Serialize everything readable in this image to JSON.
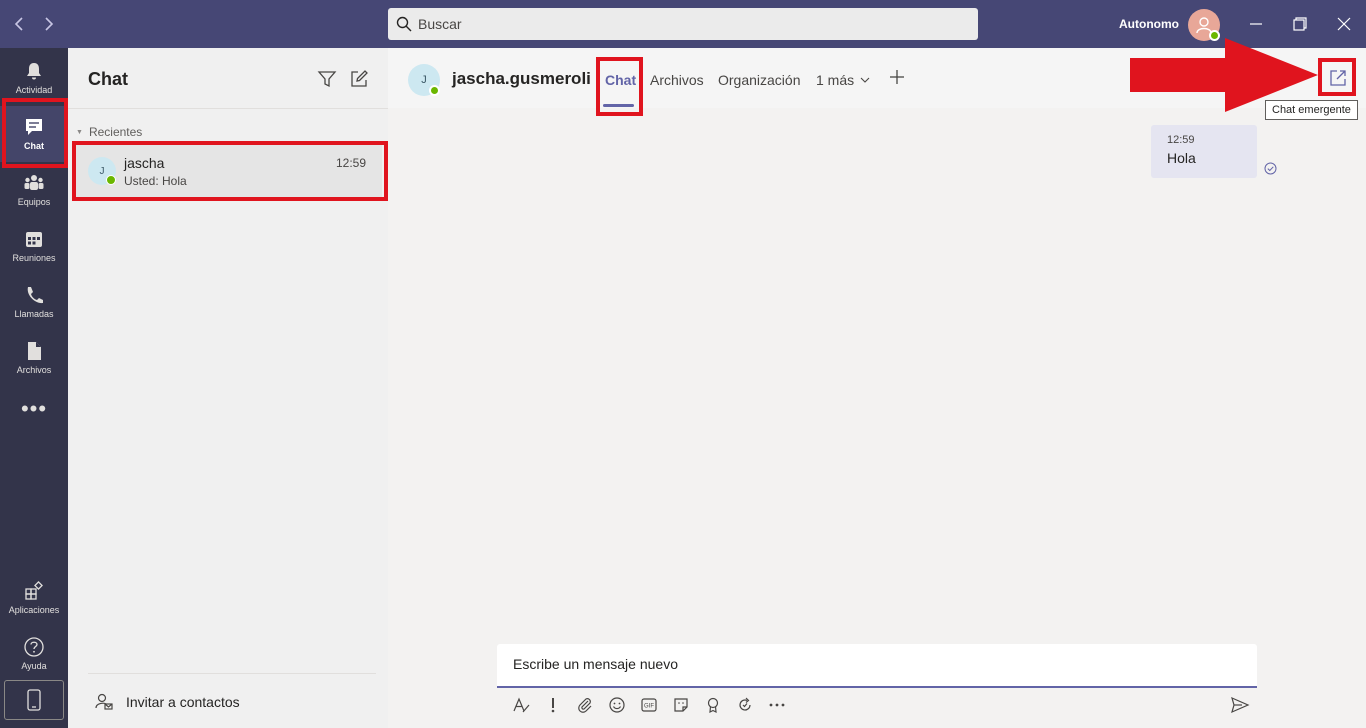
{
  "titlebar": {
    "search_placeholder": "Buscar",
    "user_name": "Autonomo",
    "icons": [
      "chevron-left-icon",
      "chevron-right-icon",
      "search-icon",
      "minimize-icon",
      "maximize-icon",
      "close-icon"
    ]
  },
  "rail": {
    "items": [
      {
        "label": "Actividad",
        "icon": "bell-icon"
      },
      {
        "label": "Chat",
        "icon": "chat-icon"
      },
      {
        "label": "Equipos",
        "icon": "teams-icon"
      },
      {
        "label": "Reuniones",
        "icon": "calendar-icon"
      },
      {
        "label": "Llamadas",
        "icon": "phone-icon"
      },
      {
        "label": "Archivos",
        "icon": "file-icon"
      }
    ],
    "more": "•••",
    "apps_label": "Aplicaciones",
    "help_label": "Ayuda"
  },
  "chatlist": {
    "title": "Chat",
    "section": "Recientes",
    "items": [
      {
        "initial": "J",
        "name": "jascha",
        "preview": "Usted: Hola",
        "time": "12:59"
      }
    ],
    "invite_label": "Invitar a contactos"
  },
  "conversation": {
    "initial": "J",
    "name": "jascha.gusmeroli",
    "tabs": [
      "Chat",
      "Archivos",
      "Organización",
      "1 más"
    ],
    "active_tab": "Chat",
    "tooltip": "Chat emergente",
    "messages": [
      {
        "time": "12:59",
        "text": "Hola"
      }
    ],
    "compose_placeholder": "Escribe un mensaje nuevo",
    "gif_label": "GIF"
  },
  "colors": {
    "brand": "#464775",
    "rail": "#33344a",
    "accent": "#6264a7",
    "presence": "#6bb700",
    "annotation": "#e0141e"
  }
}
